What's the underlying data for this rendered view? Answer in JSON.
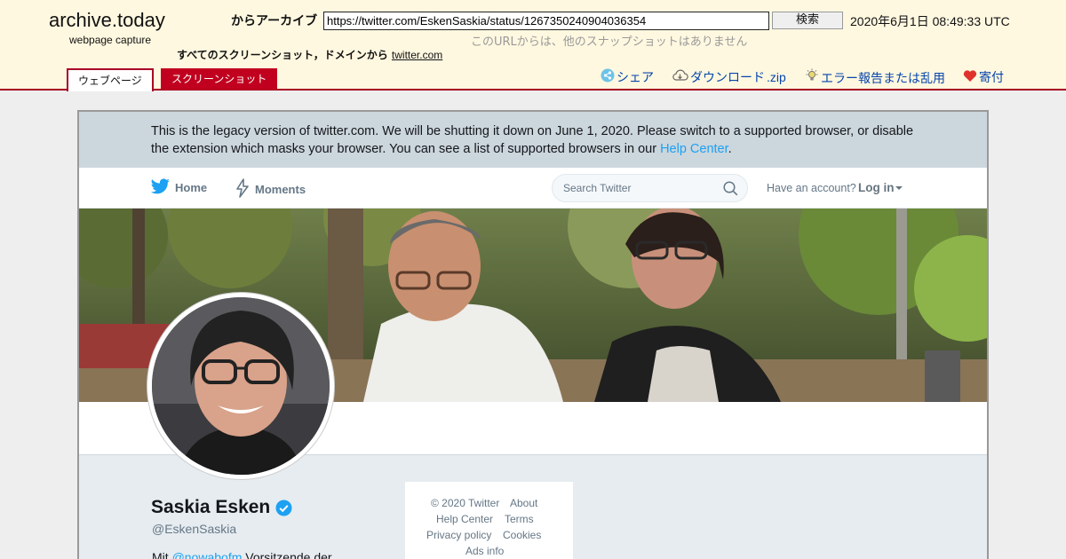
{
  "archive": {
    "site_title": "archive.today",
    "site_subtitle": "webpage capture",
    "archive_from_label": "からアーカイブ",
    "url_value": "https://twitter.com/EskenSaskia/status/1267350240904036354",
    "search_button": "検索",
    "capture_date": "2020年6月1日 08:49:33 UTC",
    "no_snapshots": "このURLからは、他のスナップショットはありません",
    "all_screenshots_label": "すべてのスクリーンショット，ドメインから",
    "domain_link": "twitter.com",
    "tabs": [
      "ウェブページ",
      "スクリーンショット"
    ],
    "tools": {
      "share": "シェア",
      "download": "ダウンロード",
      "download_ext": ".zip",
      "report": "エラー報告または乱用",
      "donate": "寄付"
    },
    "colors": {
      "accent": "#a80025",
      "header_bg": "#fff8e0",
      "link": "#0645ad"
    }
  },
  "twitter": {
    "legacy_banner": {
      "text": "This is the legacy version of twitter.com. We will be shutting it down on June 1, 2020. Please switch to a supported browser, or disable the extension which masks your browser. You can see a list of supported browsers in our",
      "link": "Help Center",
      "end": "."
    },
    "nav": {
      "home": "Home",
      "moments": "Moments",
      "search_placeholder": "Search Twitter",
      "have_account": "Have an account?",
      "login": "Log in"
    },
    "profile": {
      "name": "Saskia Esken",
      "handle": "@EskenSaskia",
      "bio_prefix": "Mit",
      "bio_mention": "@nowabofm",
      "bio_rest": "Vorsitzende der"
    },
    "footer": {
      "copyright": "© 2020 Twitter",
      "about": "About",
      "help_center": "Help Center",
      "terms": "Terms",
      "privacy": "Privacy policy",
      "cookies": "Cookies",
      "ads_info": "Ads info"
    },
    "colors": {
      "brand": "#1da1f2",
      "banner_bg": "#ccd6dd",
      "page_bg": "#e6ecf0"
    }
  }
}
